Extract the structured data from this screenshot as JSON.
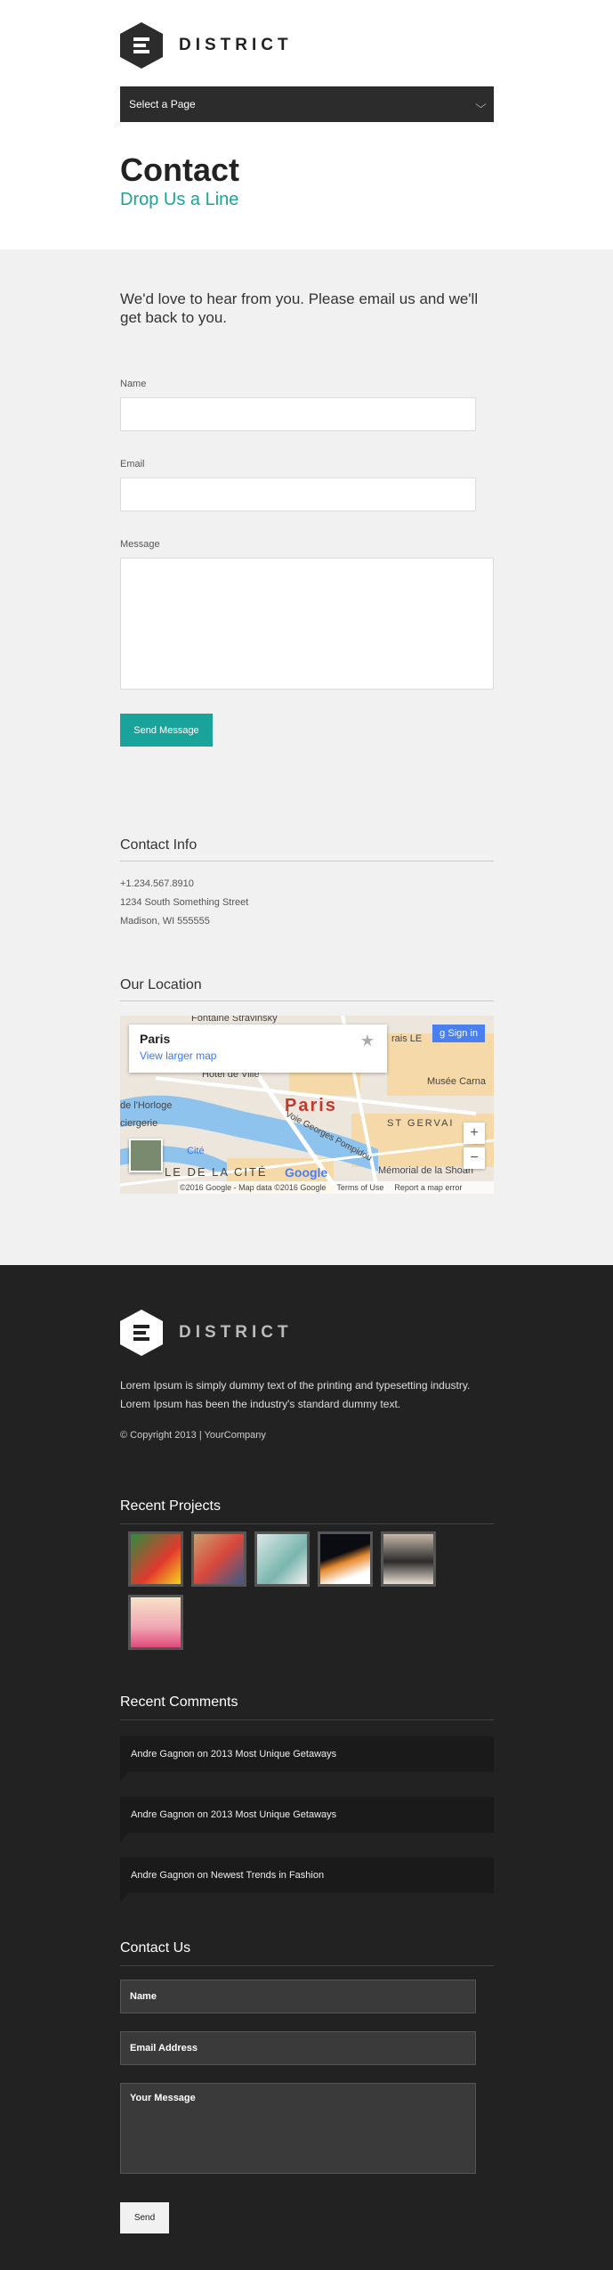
{
  "brand": {
    "name": "DISTRICT"
  },
  "nav": {
    "select_label": "Select a Page"
  },
  "page": {
    "title": "Contact",
    "subtitle": "Drop Us a Line"
  },
  "contact_form": {
    "intro": "We'd love to hear from you. Please email us and we'll get back to you.",
    "name_label": "Name",
    "email_label": "Email",
    "message_label": "Message",
    "submit_label": "Send Message"
  },
  "contact_info": {
    "title": "Contact Info",
    "phone": "+1.234.567.8910",
    "street": "1234 South Something Street",
    "city": "Madison, WI 555555"
  },
  "location": {
    "title": "Our Location",
    "popup_city": "Paris",
    "popup_link": "View larger map",
    "sign_in": "Sign in",
    "map_city_label": "Paris",
    "labels": [
      "Hôtel de Ville",
      "Musée Carna",
      "ST GERVAI",
      "LE DE LA CITÉ",
      "Mémorial de la Shoah",
      "Fontaine Stravinsky",
      "ciergerie",
      "de l'Horloge",
      "Cité",
      "rais LE",
      "Voie Georges Pompidou"
    ],
    "footer_data": "©2016 Google - Map data ©2016 Google",
    "terms": "Terms of Use",
    "report": "Report a map error",
    "zoom_in": "+",
    "zoom_out": "−",
    "google": "Google"
  },
  "footer": {
    "brand": "DISTRICT",
    "about": "Lorem Ipsum is simply dummy text of the printing and typesetting industry. Lorem Ipsum has been the industry's standard dummy text.",
    "copyright": "© Copyright 2013 | YourCompany",
    "projects_title": "Recent Projects",
    "comments_title": "Recent Comments",
    "comments": [
      "Andre Gagnon on 2013 Most Unique Getaways",
      "Andre Gagnon on 2013 Most Unique Getaways",
      "Andre Gagnon on Newest Trends in Fashion"
    ],
    "contact_title": "Contact Us",
    "name_placeholder": "Name",
    "email_placeholder": "Email Address",
    "message_placeholder": "Your Message",
    "send_label": "Send"
  },
  "colors": {
    "accent": "#1aa39b",
    "dark": "#222222",
    "light_bg": "#f1f1f1"
  }
}
